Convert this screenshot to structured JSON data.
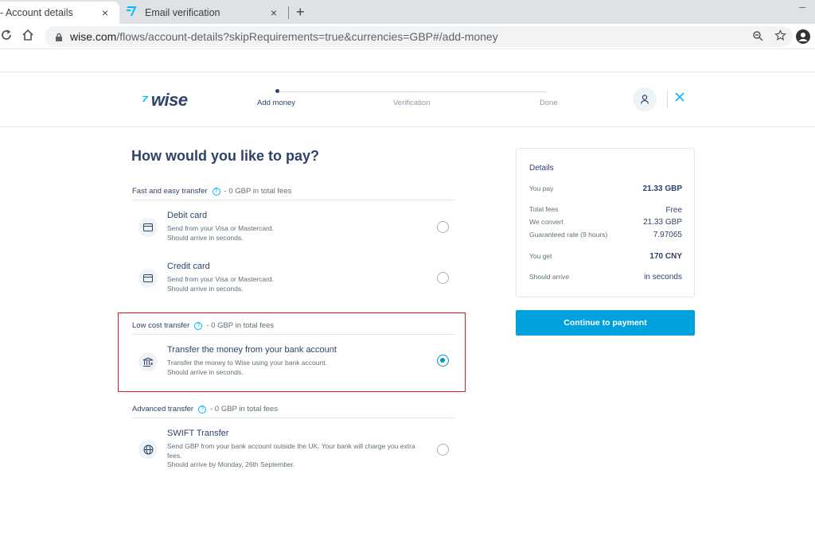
{
  "browser": {
    "tabs": [
      {
        "title": "- Account details",
        "close": "×"
      },
      {
        "title": "Email verification",
        "close": "×"
      }
    ],
    "new_tab": "+",
    "minimize": "–",
    "url_host": "wise.com",
    "url_path": "/flows/account-details?skipRequirements=true&currencies=GBP#/add-money"
  },
  "header": {
    "logo": "wise",
    "steps": [
      "Add money",
      "Verification",
      "Done"
    ],
    "active_step": 0
  },
  "main": {
    "heading": "How would you like to pay?",
    "sections": [
      {
        "label": "Fast and easy transfer",
        "fees": "- 0 GBP in total fees",
        "options": [
          {
            "title": "Debit card",
            "desc1": "Send from your Visa or Mastercard.",
            "desc2": "Should arrive in seconds.",
            "icon": "card-icon",
            "checked": false
          },
          {
            "title": "Credit card",
            "desc1": "Send from your Visa or Mastercard.",
            "desc2": "Should arrive in seconds.",
            "icon": "card-icon",
            "checked": false
          }
        ]
      },
      {
        "label": "Low cost transfer",
        "fees": "- 0 GBP in total fees",
        "options": [
          {
            "title": "Transfer the money from your bank account",
            "desc1": "Transfer the money to Wise using your bank account.",
            "desc2": "Should arrive in seconds.",
            "icon": "bank-icon",
            "checked": true
          }
        ]
      },
      {
        "label": "Advanced transfer",
        "fees": "- 0 GBP in total fees",
        "options": [
          {
            "title": "SWIFT Transfer",
            "desc1": "Send GBP from your bank account outside the UK. Your bank will charge you extra fees.",
            "desc2": "Should arrive by Monday, 26th September.",
            "icon": "globe-icon",
            "checked": false
          }
        ]
      }
    ]
  },
  "details": {
    "title": "Details",
    "you_pay_label": "You pay",
    "you_pay_value": "21.33 GBP",
    "total_fees_label": "Total fees",
    "total_fees_value": "Free",
    "we_convert_label": "We convert",
    "we_convert_value": "21.33 GBP",
    "rate_label": "Guaranteed rate (9 hours)",
    "rate_value": "7.97065",
    "you_get_label": "You get",
    "you_get_value": "170 CNY",
    "arrive_label": "Should arrive",
    "arrive_value": "in seconds"
  },
  "continue_label": "Continue to payment",
  "colors": {
    "accent": "#00a2dd",
    "brand_blue": "#00b9ff",
    "highlight": "#e0161b",
    "text": "#2e4369"
  }
}
